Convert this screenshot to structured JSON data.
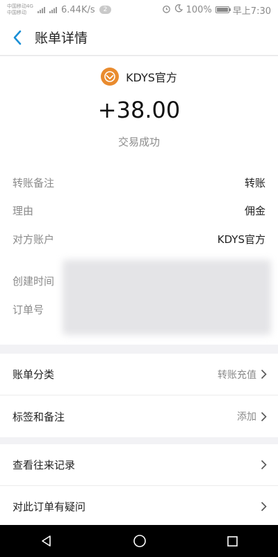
{
  "status_bar": {
    "carrier_line1": "中国移动4G",
    "carrier_line2": "中国移动",
    "speed": "6.44K/s",
    "notification_count": "2",
    "battery": "100%",
    "time": "早上7:30"
  },
  "header": {
    "title": "账单详情"
  },
  "summary": {
    "merchant": "KDYS官方",
    "amount": "+38.00",
    "status": "交易成功"
  },
  "details": [
    {
      "label": "转账备注",
      "value": "转账"
    },
    {
      "label": "理由",
      "value": "佣金"
    },
    {
      "label": "对方账户",
      "value": "KDYS官方"
    },
    {
      "label": "创建时间",
      "value": ""
    },
    {
      "label": "订单号",
      "value": ""
    }
  ],
  "actions_1": [
    {
      "label": "账单分类",
      "value": "转账充值"
    },
    {
      "label": "标签和备注",
      "value": "添加"
    }
  ],
  "actions_2": [
    {
      "label": "查看往来记录"
    },
    {
      "label": "对此订单有疑问"
    }
  ],
  "colors": {
    "accent": "#1a8fd6",
    "logo": "#e98b2e",
    "page_bg": "#f2f2f5"
  }
}
